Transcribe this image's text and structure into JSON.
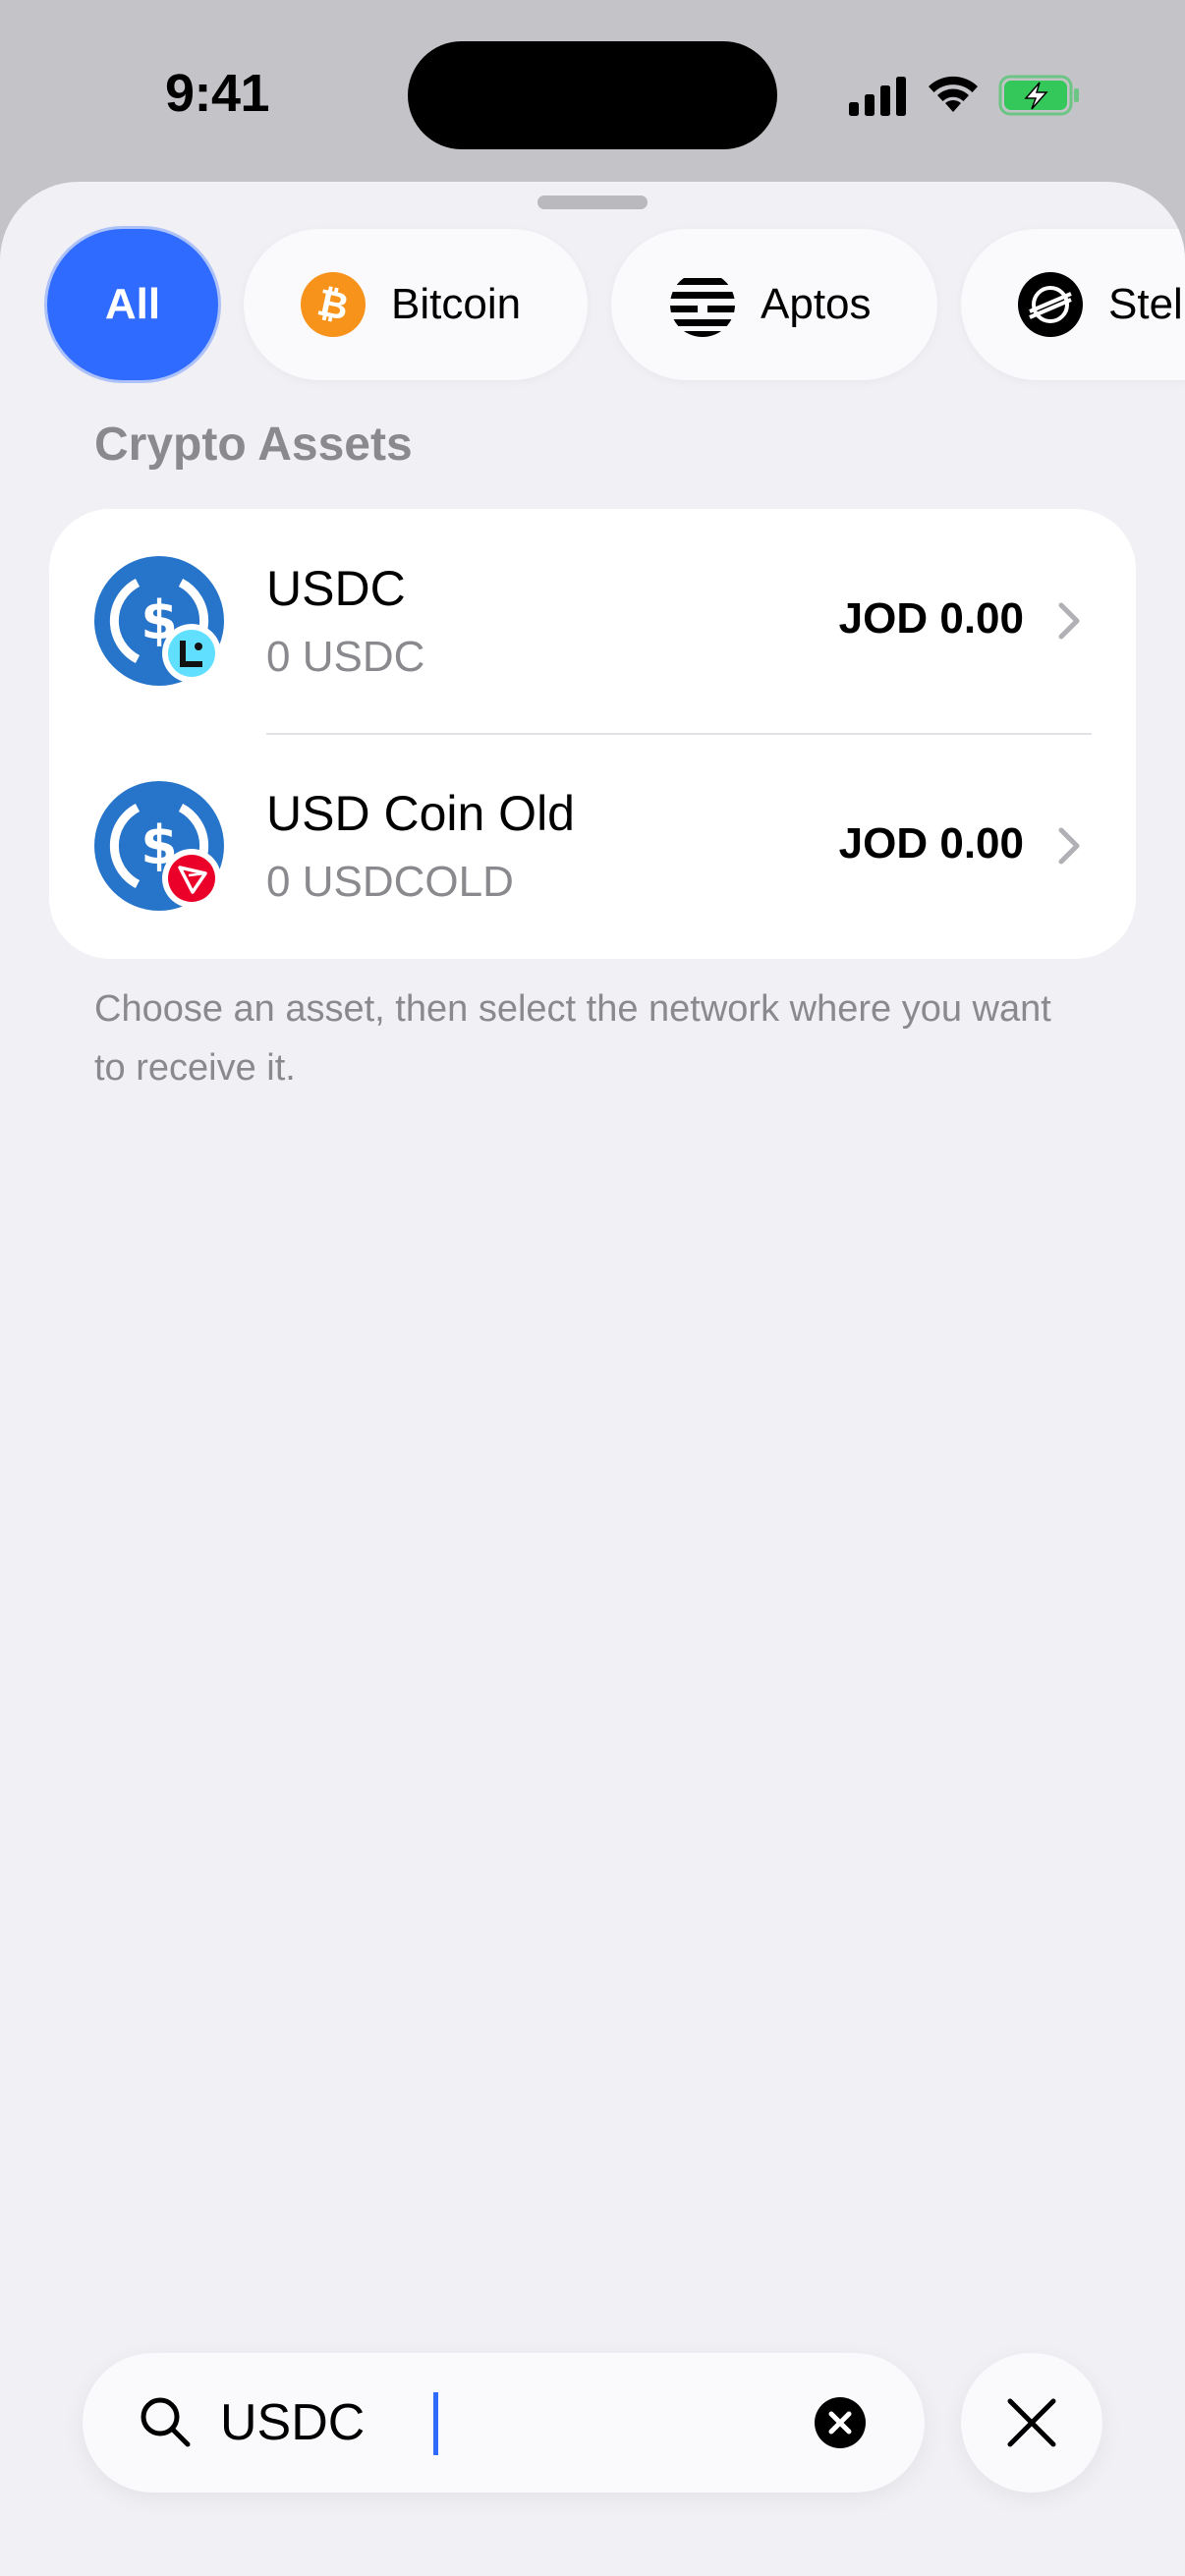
{
  "status_bar": {
    "time": "9:41"
  },
  "filters": {
    "chips": [
      {
        "label": "All",
        "selected": true
      },
      {
        "label": "Bitcoin",
        "icon": "bitcoin-icon"
      },
      {
        "label": "Aptos",
        "icon": "aptos-icon"
      },
      {
        "label": "Stel",
        "icon": "stellar-icon"
      }
    ]
  },
  "section": {
    "title": "Crypto Assets"
  },
  "assets": [
    {
      "name": "USDC",
      "balance": "0 USDC",
      "fiat": "JOD 0.00",
      "icon": "usdc-icon",
      "network_badge": "linea-badge-icon"
    },
    {
      "name": "USD Coin Old",
      "balance": "0 USDCOLD",
      "fiat": "JOD 0.00",
      "icon": "usdc-icon",
      "network_badge": "tron-badge-icon"
    }
  ],
  "footnote": "Choose an asset, then select the network where you want to receive it.",
  "search": {
    "value": "USDC"
  },
  "colors": {
    "accent": "#2f6bff",
    "usdc_blue": "#2775ca",
    "bitcoin_orange": "#f7931a",
    "tron_red": "#eb0029",
    "battery_green": "#34c759"
  }
}
